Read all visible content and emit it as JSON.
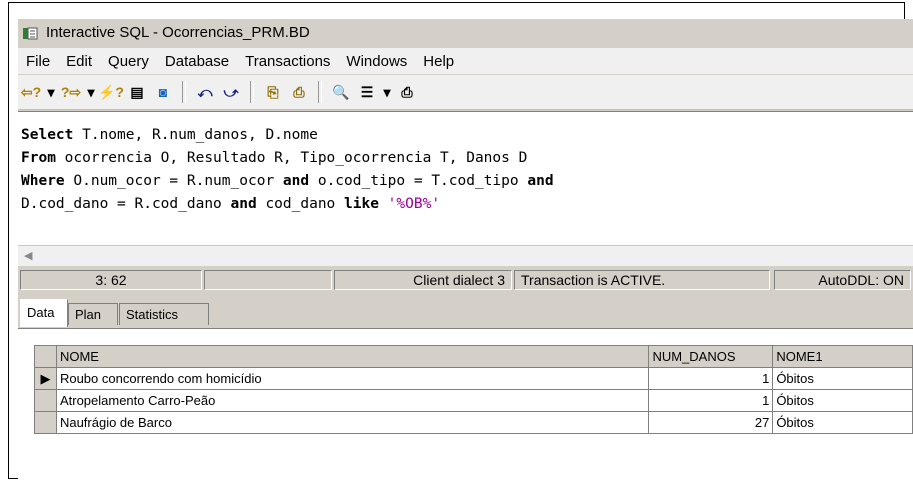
{
  "window": {
    "title": "Interactive SQL - Ocorrencias_PRM.BD"
  },
  "menu": [
    "File",
    "Edit",
    "Query",
    "Database",
    "Transactions",
    "Windows",
    "Help"
  ],
  "toolbar": {
    "prev_query": "⇦?",
    "next_query": "?⇨",
    "execute": "⚡?",
    "dropdown": "▾",
    "commit": "▤",
    "rollback": "◙",
    "undo": "⤺",
    "redo": "⤻",
    "copy": "⎘",
    "paste": "⎙",
    "find": "🔍",
    "options": "☰",
    "print": "⎙"
  },
  "editor": {
    "line1_kw": "Select",
    "line1_rest": " T.nome, R.num_danos, D.nome",
    "line2_kw": "From",
    "line2_rest": " ocorrencia O, Resultado R, Tipo_ocorrencia T, Danos D",
    "line3_kw": "Where",
    "line3_mid1": " O.num_ocor = R.num_ocor ",
    "line3_and1": "and",
    "line3_mid2": " o.cod_tipo = T.cod_tipo ",
    "line3_and2": "and",
    "line4_start": "D.cod_dano = R.cod_dano ",
    "line4_and": "and",
    "line4_mid": " cod_dano ",
    "line4_like": "like",
    "line4_str": " '%OB%'"
  },
  "status": {
    "position": "3: 62",
    "dialect": "Client dialect 3",
    "transaction": "Transaction is ACTIVE.",
    "autoddl": "AutoDDL: ON"
  },
  "tabs": [
    "Data",
    "Plan",
    "Statistics"
  ],
  "grid": {
    "columns": [
      "NOME",
      "NUM_DANOS",
      "NOME1"
    ],
    "current_row_marker": "▶",
    "rows": [
      {
        "nome": "Roubo concorrendo com homicídio",
        "num_danos": "1",
        "nome1": "Óbitos"
      },
      {
        "nome": "Atropelamento Carro-Peão",
        "num_danos": "1",
        "nome1": "Óbitos"
      },
      {
        "nome": "Naufrágio de Barco",
        "num_danos": "27",
        "nome1": "Óbitos"
      }
    ]
  }
}
